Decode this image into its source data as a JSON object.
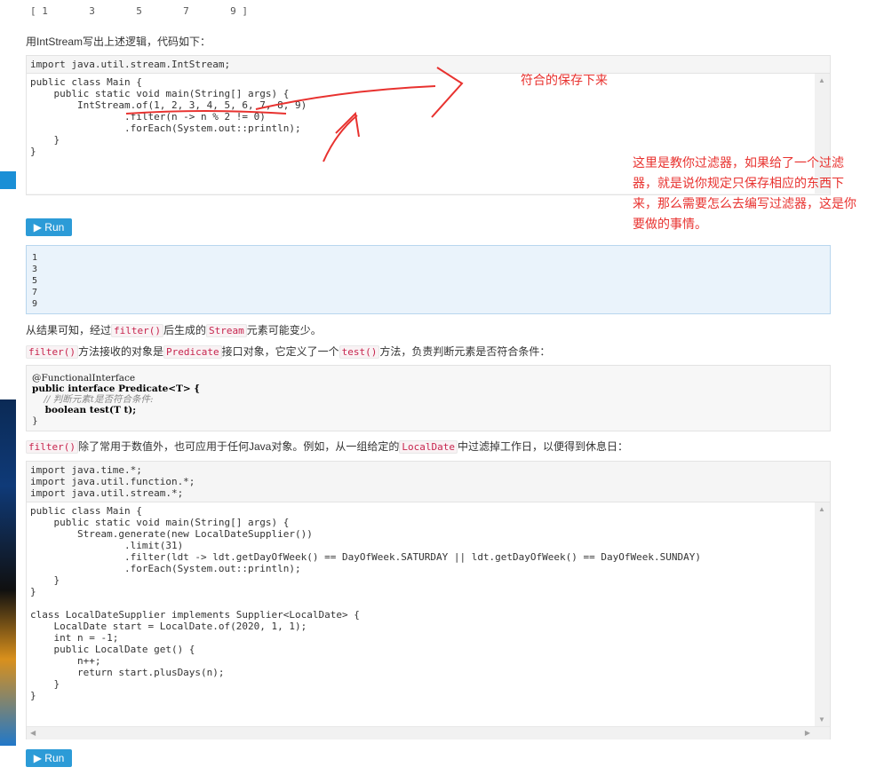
{
  "stream_values_line": "[ 1       3       5       7       9 ]",
  "intro_text": "用IntStream写出上述逻辑，代码如下：",
  "editor1": {
    "header_code": "import java.util.stream.IntStream;",
    "body_code": "public class Main {\n    public static void main(String[] args) {\n        IntStream.of(1, 2, 3, 4, 5, 6, 7, 8, 9)\n                .filter(n -> n % 2 != 0)\n                .forEach(System.out::println);\n    }\n}"
  },
  "run_label": "Run",
  "output_lines": [
    "1",
    "3",
    "5",
    "7",
    "9"
  ],
  "para1": {
    "a": "从结果可知，经过",
    "code1": "filter()",
    "b": "后生成的",
    "code2": "Stream",
    "c": "元素可能变少。"
  },
  "para2": {
    "code1": "filter()",
    "a": "方法接收的对象是",
    "code2": "Predicate",
    "b": "接口对象，它定义了一个",
    "code3": "test()",
    "c": "方法，负责判断元素是否符合条件："
  },
  "predicate_box": {
    "annotation": "@FunctionalInterface",
    "decl": "public interface Predicate<T> {",
    "comment": "    // 判断元素t是否符合条件:",
    "method": "    boolean test(T t);",
    "close": "}"
  },
  "para3": {
    "code1": "filter()",
    "a": "除了常用于数值外，也可应用于任何Java对象。例如，从一组给定的",
    "code2": "LocalDate",
    "b": "中过滤掉工作日，以便得到休息日："
  },
  "editor2": {
    "header_code": "import java.time.*;\nimport java.util.function.*;\nimport java.util.stream.*;",
    "body_code": "public class Main {\n    public static void main(String[] args) {\n        Stream.generate(new LocalDateSupplier())\n                .limit(31)\n                .filter(ldt -> ldt.getDayOfWeek() == DayOfWeek.SATURDAY || ldt.getDayOfWeek() == DayOfWeek.SUNDAY)\n                .forEach(System.out::println);\n    }\n}\n\nclass LocalDateSupplier implements Supplier<LocalDate> {\n    LocalDate start = LocalDate.of(2020, 1, 1);\n    int n = -1;\n    public LocalDate get() {\n        n++;\n        return start.plusDays(n);\n    }\n}"
  },
  "notes": {
    "keep": "符合的保存下来",
    "explain": "这里是教你过滤器，如果给了一个过滤器，就是说你规定只保存相应的东西下来，那么需要怎么去编写过滤器，这是你要做的事情。"
  },
  "colors": {
    "accent": "#2c9bd7",
    "annotation": "#e8322f"
  },
  "icons": {
    "run": "play-icon",
    "scroll_up": "triangle-up-icon",
    "scroll_down": "triangle-down-icon"
  }
}
